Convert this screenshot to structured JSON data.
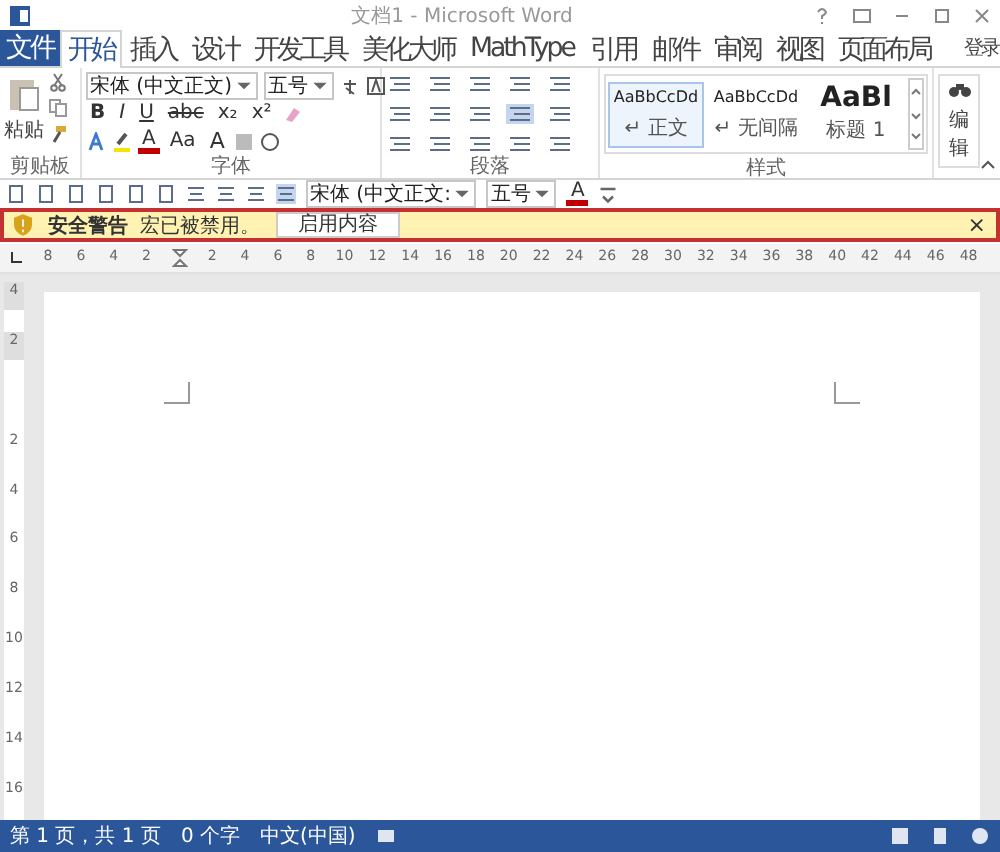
{
  "window": {
    "title": "文档1 - Microsoft Word"
  },
  "tabs": [
    {
      "label": "文件",
      "kind": "file",
      "selected": false
    },
    {
      "label": "开始",
      "kind": "tab",
      "selected": true
    },
    {
      "label": "插入",
      "kind": "tab",
      "selected": false
    },
    {
      "label": "设计",
      "kind": "tab",
      "selected": false
    },
    {
      "label": "开发工具",
      "kind": "tab",
      "selected": false
    },
    {
      "label": "美化大师",
      "kind": "tab",
      "selected": false
    },
    {
      "label": "MathType",
      "kind": "tab",
      "selected": false
    },
    {
      "label": "引用",
      "kind": "tab",
      "selected": false
    },
    {
      "label": "邮件",
      "kind": "tab",
      "selected": false
    },
    {
      "label": "审阅",
      "kind": "tab",
      "selected": false
    },
    {
      "label": "视图",
      "kind": "tab",
      "selected": false
    },
    {
      "label": "页面布局",
      "kind": "tab",
      "selected": false
    }
  ],
  "sign_in": "登录",
  "ribbon": {
    "clipboard": {
      "paste": "粘贴",
      "label": "剪贴板"
    },
    "font": {
      "name": "宋体 (中文正文)",
      "size": "五号",
      "buttons": [
        "B",
        "I",
        "U",
        "abc",
        "x₂",
        "x²"
      ],
      "row3": [
        "A",
        "Aa",
        "A"
      ],
      "label": "字体"
    },
    "paragraph": {
      "label": "段落"
    },
    "styles": {
      "items": [
        {
          "sample": "AaBbCcDd",
          "name": "↵ 正文",
          "kind": "small",
          "selected": true
        },
        {
          "sample": "AaBbCcDd",
          "name": "↵ 无间隔",
          "kind": "small",
          "selected": false
        },
        {
          "sample": "AaBl",
          "name": "标题 1",
          "kind": "heading",
          "selected": false
        }
      ],
      "label": "样式"
    },
    "editing": {
      "label": "编辑"
    }
  },
  "quick_toolbar": {
    "font": "宋体 (中文正文:",
    "size": "五号",
    "color_button": "A"
  },
  "warning": {
    "title": "安全警告",
    "message": "宏已被禁用。",
    "button": "启用内容",
    "close": "×"
  },
  "ruler": {
    "marks": [
      "8",
      "6",
      "4",
      "2",
      "2",
      "4",
      "6",
      "8",
      "10",
      "12",
      "14",
      "16",
      "18",
      "20",
      "22",
      "24",
      "26",
      "28",
      "30",
      "32",
      "34",
      "36",
      "38",
      "40",
      "42",
      "44",
      "46",
      "48"
    ],
    "vertical": [
      "4",
      "2",
      "2",
      "4",
      "6",
      "8",
      "10",
      "12",
      "14",
      "16"
    ]
  },
  "status_bar": {
    "page": "第 1 页，共 1 页",
    "words": "0 个字",
    "language": "中文(中国)"
  }
}
